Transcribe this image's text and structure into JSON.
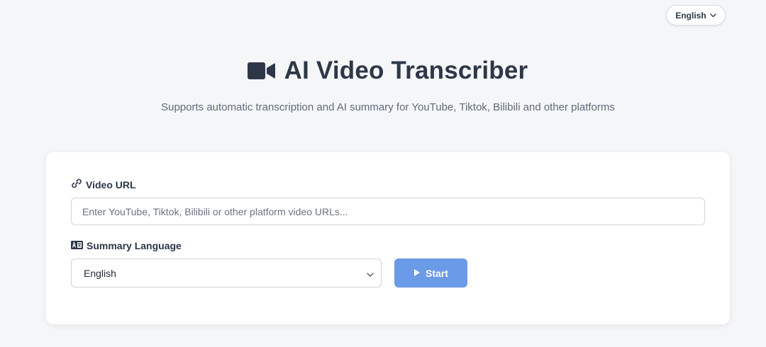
{
  "header": {
    "language_button": {
      "label": "English",
      "icon": "chevron-down-icon"
    }
  },
  "hero": {
    "title": "AI Video Transcriber",
    "title_icon": "video-camera-icon",
    "subtitle": "Supports automatic transcription and AI summary for YouTube, Tiktok, Bilibili and other platforms"
  },
  "form": {
    "url_field": {
      "label": "Video URL",
      "icon": "link-icon",
      "value": "",
      "placeholder": "Enter YouTube, Tiktok, Bilibili or other platform video URLs..."
    },
    "summary_language": {
      "label": "Summary Language",
      "icon": "language-icon",
      "selected": "English"
    },
    "start_button": {
      "label": "Start",
      "icon": "play-icon"
    }
  },
  "colors": {
    "background": "#f5f6f8",
    "text": "#2d3748",
    "accent": "#6b9ae6",
    "card": "#ffffff"
  }
}
